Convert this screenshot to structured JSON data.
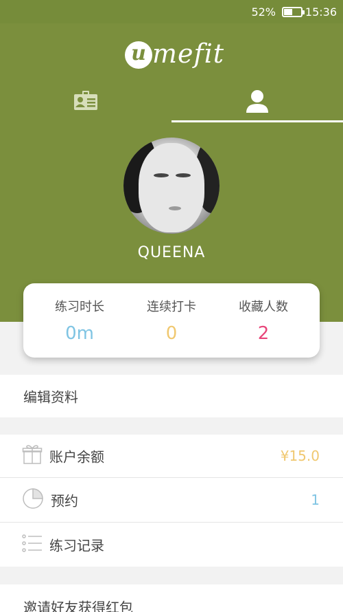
{
  "status_bar": {
    "battery_percent": "52%",
    "time": "15:36",
    "battery_level": 0.52
  },
  "header": {
    "logo": {
      "mark": "u",
      "wordmark": "mefit"
    },
    "tabs": [
      {
        "icon": "id-card-icon",
        "selected": false
      },
      {
        "icon": "user-icon",
        "selected": true
      }
    ]
  },
  "profile": {
    "username": "QUEENA"
  },
  "stats": [
    {
      "label": "练习时长",
      "value": "0m",
      "color": "#7fc4e3"
    },
    {
      "label": "连续打卡",
      "value": "0",
      "color": "#f0c870"
    },
    {
      "label": "收藏人数",
      "value": "2",
      "color": "#e8467a"
    }
  ],
  "menu": {
    "edit_profile": "编辑资料",
    "items": [
      {
        "icon": "gift-icon",
        "label": "账户余额",
        "value": "¥15.0",
        "value_color": "#f0c870"
      },
      {
        "icon": "clock-icon",
        "label": "预约",
        "value": "1",
        "value_color": "#7fc4e3"
      },
      {
        "icon": "list-icon",
        "label": "练习记录",
        "value": ""
      }
    ],
    "invite": "邀请好友获得红包"
  }
}
